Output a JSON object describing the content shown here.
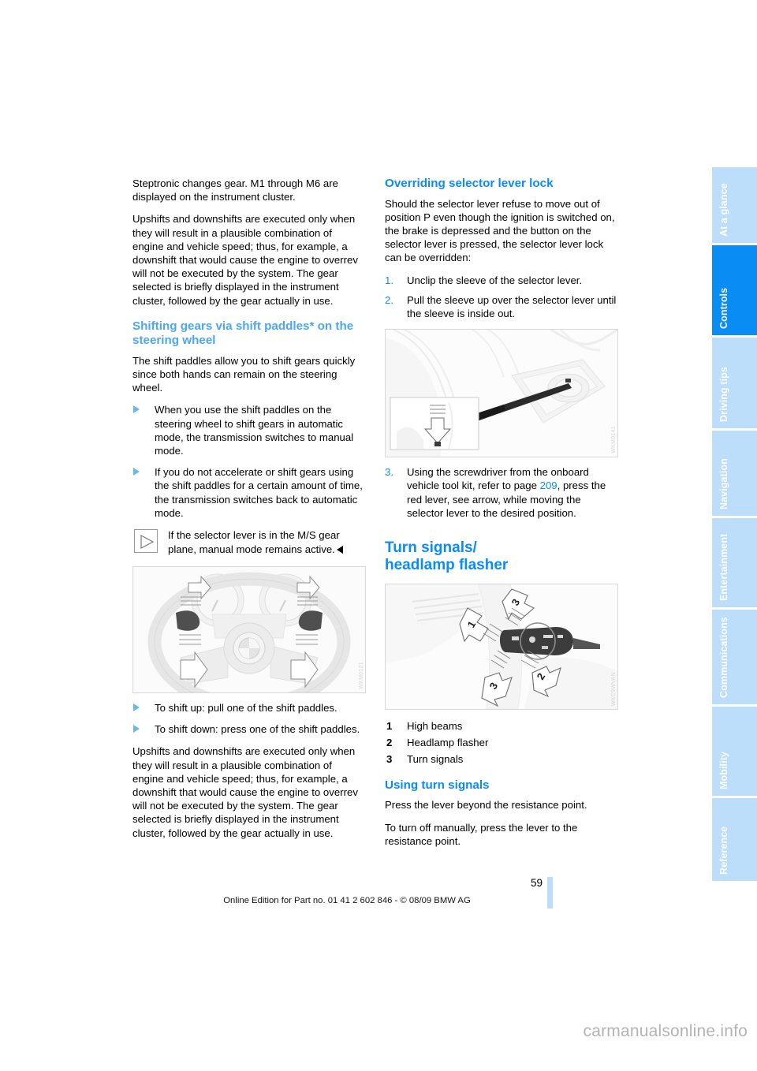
{
  "page": {
    "number": "59",
    "footer_line": "Online Edition for Part no. 01 41 2 602 846 - © 08/09 BMW AG",
    "watermark": "carmanualsonline.info"
  },
  "colors": {
    "accent_blue": "#0a8cf5",
    "light_blue": "#bcdefb",
    "heading_blue": "#4da6f0"
  },
  "side_tabs": [
    {
      "label": "At a glance",
      "active": false
    },
    {
      "label": "Controls",
      "active": true
    },
    {
      "label": "Driving tips",
      "active": false
    },
    {
      "label": "Navigation",
      "active": false
    },
    {
      "label": "Entertainment",
      "active": false
    },
    {
      "label": "Communications",
      "active": false
    },
    {
      "label": "Mobility",
      "active": false
    },
    {
      "label": "Reference",
      "active": false
    }
  ],
  "left_column": {
    "para_1": "Steptronic changes gear. M1 through M6 are displayed on the instrument cluster.",
    "para_2": "Upshifts and downshifts are executed only when they will result in a plausible combination of engine and vehicle speed; thus, for example, a downshift that would cause the engine to overrev will not be executed by the system. The gear selected is briefly displayed in the instrument cluster, followed by the gear actually in use.",
    "heading_shift_paddles": "Shifting gears via shift paddles* on the steering wheel",
    "para_3": "The shift paddles allow you to shift gears quickly since both hands can remain on the steering wheel.",
    "bullets_1": [
      "When you use the shift paddles on the steering wheel to shift gears in automatic mode, the transmission switches to manual mode.",
      "If you do not accelerate or shift gears using the shift paddles for a certain amount of time, the transmission switches back to automatic mode."
    ],
    "note": "If the selector lever is in the M/S gear plane, manual mode remains active.",
    "figure_steering_wheel": {
      "alt": "Steering wheel with shift paddles and up/down arrows",
      "code": "WKM0121"
    },
    "bullets_2": [
      "To shift up: pull one of the shift paddles.",
      "To shift down: press one of the shift paddles."
    ],
    "para_4": "Upshifts and downshifts are executed only when they will result in a plausible combination of engine and vehicle speed; thus, for example, a downshift that would cause the engine to overrev will not be executed by the system. The gear selected is briefly displayed in the instrument cluster, followed by the gear actually in use."
  },
  "right_column": {
    "heading_override": "Overriding selector lever lock",
    "para_1": "Should the selector lever refuse to move out of position P even though the ignition is switched on, the brake is depressed and the button on the selector lever is pressed, the selector lever lock can be overridden:",
    "steps_1_2": [
      {
        "num": "1.",
        "text": "Unclip the sleeve of the selector lever."
      },
      {
        "num": "2.",
        "text": "Pull the sleeve up over the selector lever until the sleeve is inside out."
      }
    ],
    "figure_selector_lever": {
      "alt": "Screwdriver pressing red lever beside selector lever, with inset detail arrow",
      "code": "WKM0141"
    },
    "step_3": {
      "num": "3.",
      "text_before": "Using the screwdriver from the onboard vehicle tool kit, refer to page ",
      "page_ref": "209",
      "text_after": ", press the red lever, see arrow, while moving the selector lever to the desired position."
    },
    "heading_turn_signals": "Turn signals/\nheadlamp flasher",
    "figure_stalk": {
      "alt": "Turn signal / headlamp flasher stalk with numbered direction arrows 1, 2, 3",
      "code": "WKC9WVAN"
    },
    "legend": [
      {
        "num": "1",
        "label": "High beams"
      },
      {
        "num": "2",
        "label": "Headlamp flasher"
      },
      {
        "num": "3",
        "label": "Turn signals"
      }
    ],
    "heading_using": "Using turn signals",
    "para_2": "Press the lever beyond the resistance point.",
    "para_3": "To turn off manually, press the lever to the resistance point."
  }
}
